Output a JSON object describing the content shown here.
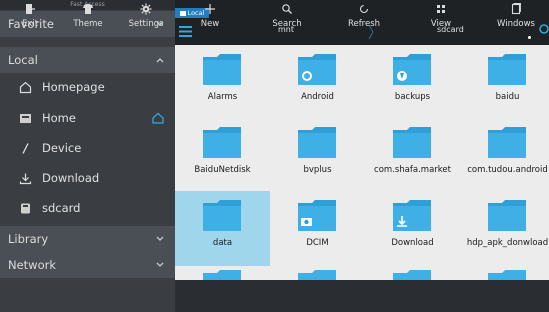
{
  "sidebar": {
    "header": "Fast Access",
    "sections": {
      "favorite": "Favorite",
      "local": "Local",
      "library": "Library",
      "network": "Network"
    },
    "items": [
      {
        "label": "Homepage",
        "icon": "home-outline-icon"
      },
      {
        "label": "Home",
        "icon": "drive-icon"
      },
      {
        "label": "Device",
        "icon": "slash-icon"
      },
      {
        "label": "Download",
        "icon": "download-icon"
      },
      {
        "label": "sdcard",
        "icon": "sdcard-icon"
      }
    ]
  },
  "topbar": {
    "window_tab": "Local",
    "path": [
      "mnt",
      "sdcard"
    ]
  },
  "grid": {
    "folders": [
      {
        "name": "Alarms",
        "overlay": ""
      },
      {
        "name": "Android",
        "overlay": "gear-icon"
      },
      {
        "name": "backups",
        "overlay": "backup-icon"
      },
      {
        "name": "baidu",
        "overlay": ""
      },
      {
        "name": "BaiduNetdisk",
        "overlay": ""
      },
      {
        "name": "bvplus",
        "overlay": ""
      },
      {
        "name": "com.shafa.market",
        "overlay": ""
      },
      {
        "name": "com.tudou.android",
        "overlay": ""
      },
      {
        "name": "data",
        "overlay": "",
        "selected": true
      },
      {
        "name": "DCIM",
        "overlay": "camera-icon"
      },
      {
        "name": "Download",
        "overlay": "download-icon"
      },
      {
        "name": "hdp_apk_donwload",
        "overlay": ""
      }
    ]
  },
  "toolbar": {
    "left": [
      {
        "label": "Exit",
        "icon": "exit-icon"
      },
      {
        "label": "Theme",
        "icon": "shirt-icon"
      },
      {
        "label": "Settings",
        "icon": "settings-icon"
      }
    ],
    "right": [
      {
        "label": "New",
        "icon": "plus-icon"
      },
      {
        "label": "Search",
        "icon": "search-icon"
      },
      {
        "label": "Refresh",
        "icon": "refresh-icon"
      },
      {
        "label": "View",
        "icon": "grid-icon"
      },
      {
        "label": "Windows",
        "icon": "windows-icon"
      }
    ]
  },
  "colors": {
    "accent": "#1f7ec2",
    "folder": "#3fb0e6",
    "selection": "#9fd6ec"
  }
}
